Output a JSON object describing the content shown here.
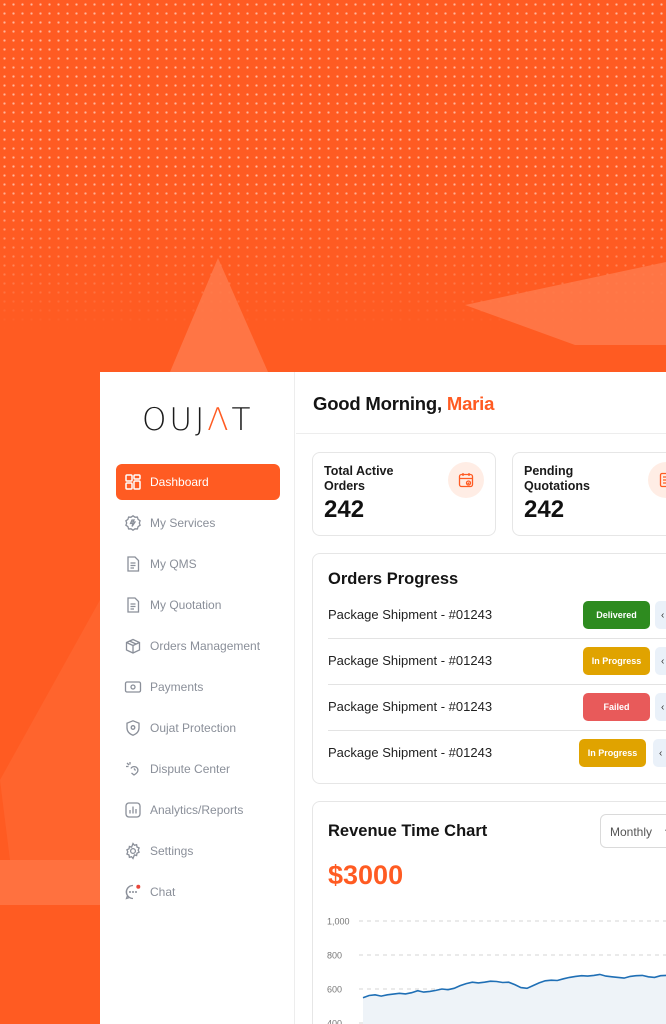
{
  "brand": {
    "logo_left": "OUJ",
    "logo_accent": "Λ",
    "logo_right": "T",
    "accent_color": "#FF5B22"
  },
  "sidebar": {
    "items": [
      {
        "label": "Dashboard",
        "icon": "grid-icon",
        "active": true
      },
      {
        "label": "My Services",
        "icon": "sparkle-gear-icon",
        "active": false
      },
      {
        "label": "My QMS",
        "icon": "document-icon",
        "active": false
      },
      {
        "label": "My Quotation",
        "icon": "document-icon",
        "active": false
      },
      {
        "label": "Orders Management",
        "icon": "box-icon",
        "active": false
      },
      {
        "label": "Payments",
        "icon": "wallet-icon",
        "active": false
      },
      {
        "label": "Oujat Protection",
        "icon": "shield-icon",
        "active": false
      },
      {
        "label": "Dispute Center",
        "icon": "dispute-icon",
        "active": false
      },
      {
        "label": "Analytics/Reports",
        "icon": "bar-chart-icon",
        "active": false
      },
      {
        "label": "Settings",
        "icon": "gear-icon",
        "active": false
      },
      {
        "label": "Chat",
        "icon": "chat-icon",
        "active": false
      }
    ]
  },
  "header": {
    "greeting": "Good Morning, ",
    "user_name": "Maria"
  },
  "stats": [
    {
      "label": "Total Active Orders",
      "value": "242",
      "icon": "calendar-check-icon"
    },
    {
      "label": "Pending Quotations",
      "value": "242",
      "icon": "document-list-icon"
    }
  ],
  "orders_progress": {
    "title": "Orders Progress",
    "rows": [
      {
        "name": "Package Shipment - #01243",
        "status": "Delivered",
        "status_color": "#2E8B1F"
      },
      {
        "name": "Package Shipment - #01243",
        "status": "In Progress",
        "status_color": "#E0A300"
      },
      {
        "name": "Package Shipment - #01243",
        "status": "Failed",
        "status_color": "#E85A5A"
      },
      {
        "name": "Package Shipment - #01243",
        "status": "In Progress",
        "status_color": "#E0A300"
      }
    ]
  },
  "revenue": {
    "title": "Revenue Time Chart",
    "amount": "$3000",
    "period_selected": "Monthly"
  },
  "chart_data": {
    "type": "area",
    "title": "Revenue Time Chart",
    "ylim": [
      400,
      1000
    ],
    "y_ticks": [
      "1,000",
      "800",
      "600",
      "400"
    ],
    "grid": true,
    "series": [
      {
        "color": "#1F6FB5",
        "values": [
          548,
          562,
          566,
          558,
          566,
          570,
          575,
          571,
          578,
          590,
          582,
          586,
          592,
          600,
          596,
          604,
          620,
          632,
          640,
          636,
          640,
          646,
          644,
          638,
          640,
          626,
          608,
          604,
          620,
          636,
          648,
          652,
          650,
          660,
          668,
          674,
          678,
          676,
          680,
          686,
          676,
          672,
          668,
          664,
          674,
          678,
          680,
          672,
          668,
          678,
          680,
          676,
          690,
          700,
          710,
          718
        ]
      }
    ]
  }
}
